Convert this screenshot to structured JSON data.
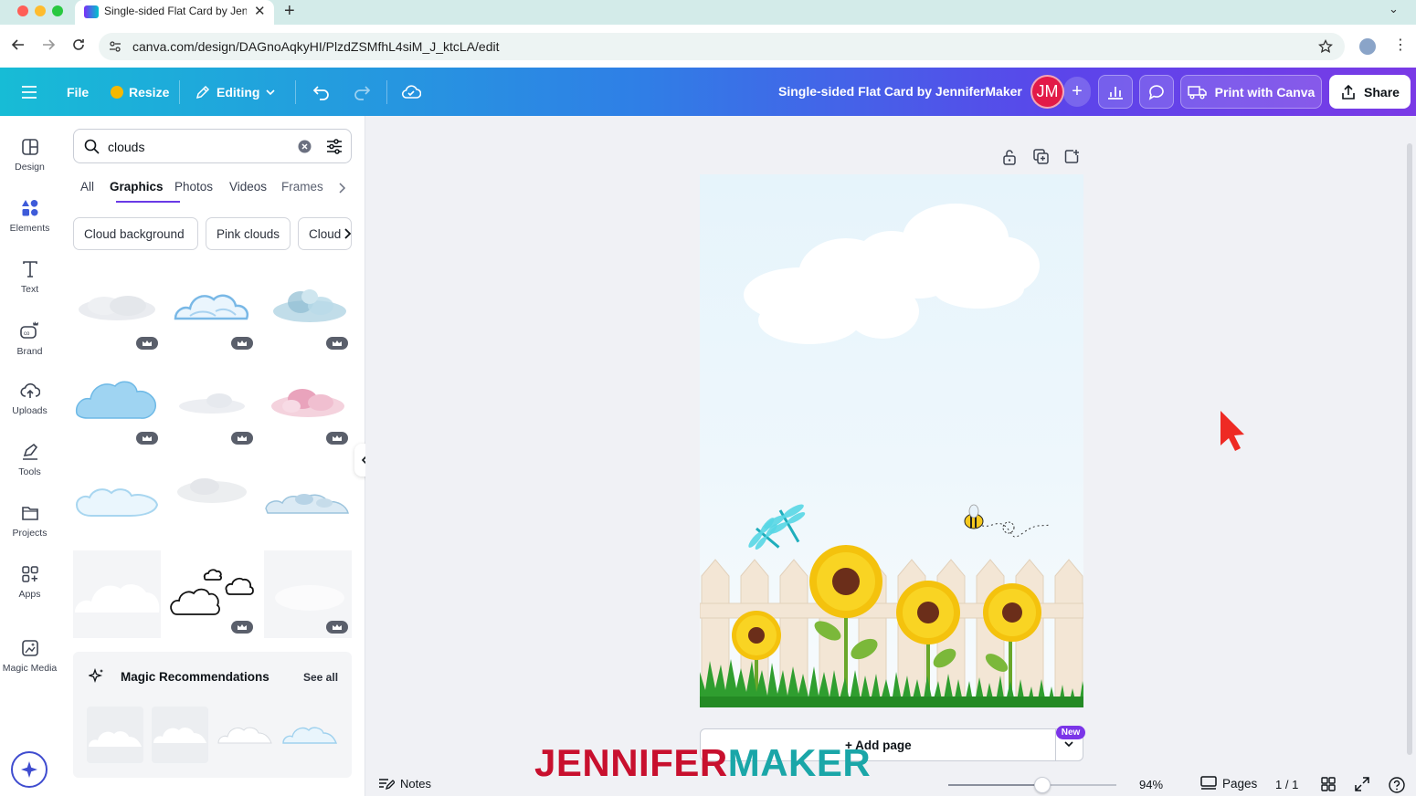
{
  "browser": {
    "tab_title": "Single-sided Flat Card by JenniferMaker",
    "url": "canva.com/design/DAGnoAqkyHI/PlzdZSMfhL4siM_J_ktcLA/edit",
    "traffic_colors": [
      "#ff5f57",
      "#febc2e",
      "#28c840"
    ]
  },
  "header": {
    "file_label": "File",
    "resize_label": "Resize",
    "editing_label": "Editing",
    "doc_title": "Single-sided Flat Card by JenniferMaker",
    "avatar_initials": "JM",
    "print_label": "Print with Canva",
    "share_label": "Share"
  },
  "rail": {
    "items": [
      {
        "label": "Design",
        "icon": "design-icon"
      },
      {
        "label": "Elements",
        "icon": "elements-icon"
      },
      {
        "label": "Text",
        "icon": "text-icon"
      },
      {
        "label": "Brand",
        "icon": "brand-icon"
      },
      {
        "label": "Uploads",
        "icon": "uploads-icon"
      },
      {
        "label": "Tools",
        "icon": "tools-icon"
      },
      {
        "label": "Projects",
        "icon": "folder-icon"
      },
      {
        "label": "Apps",
        "icon": "apps-icon"
      },
      {
        "label": "Magic Media",
        "icon": "magic-media-icon"
      }
    ],
    "active": "Elements"
  },
  "panel": {
    "search_value": "clouds",
    "tabs": [
      "All",
      "Graphics",
      "Photos",
      "Videos",
      "Frames"
    ],
    "active_tab": "Graphics",
    "chips": [
      "Cloud background",
      "Pink clouds",
      "Cloud"
    ],
    "magic_title": "Magic Recommendations",
    "see_all": "See all"
  },
  "canvas": {
    "add_page_label": "+ Add page",
    "new_badge": "New"
  },
  "footer": {
    "notes_label": "Notes",
    "zoom": "94%",
    "zoom_fraction": 0.56,
    "pages_label": "Pages",
    "page_count": "1 / 1"
  },
  "watermark": {
    "part1": "JENNIFER",
    "part2": "MAKER"
  },
  "colors": {
    "accent": "#6a3ae6",
    "header_start": "#17bcd6",
    "header_end": "#7a3ae6",
    "avatar": "#e21a48",
    "cursor": "#ee2a24"
  }
}
